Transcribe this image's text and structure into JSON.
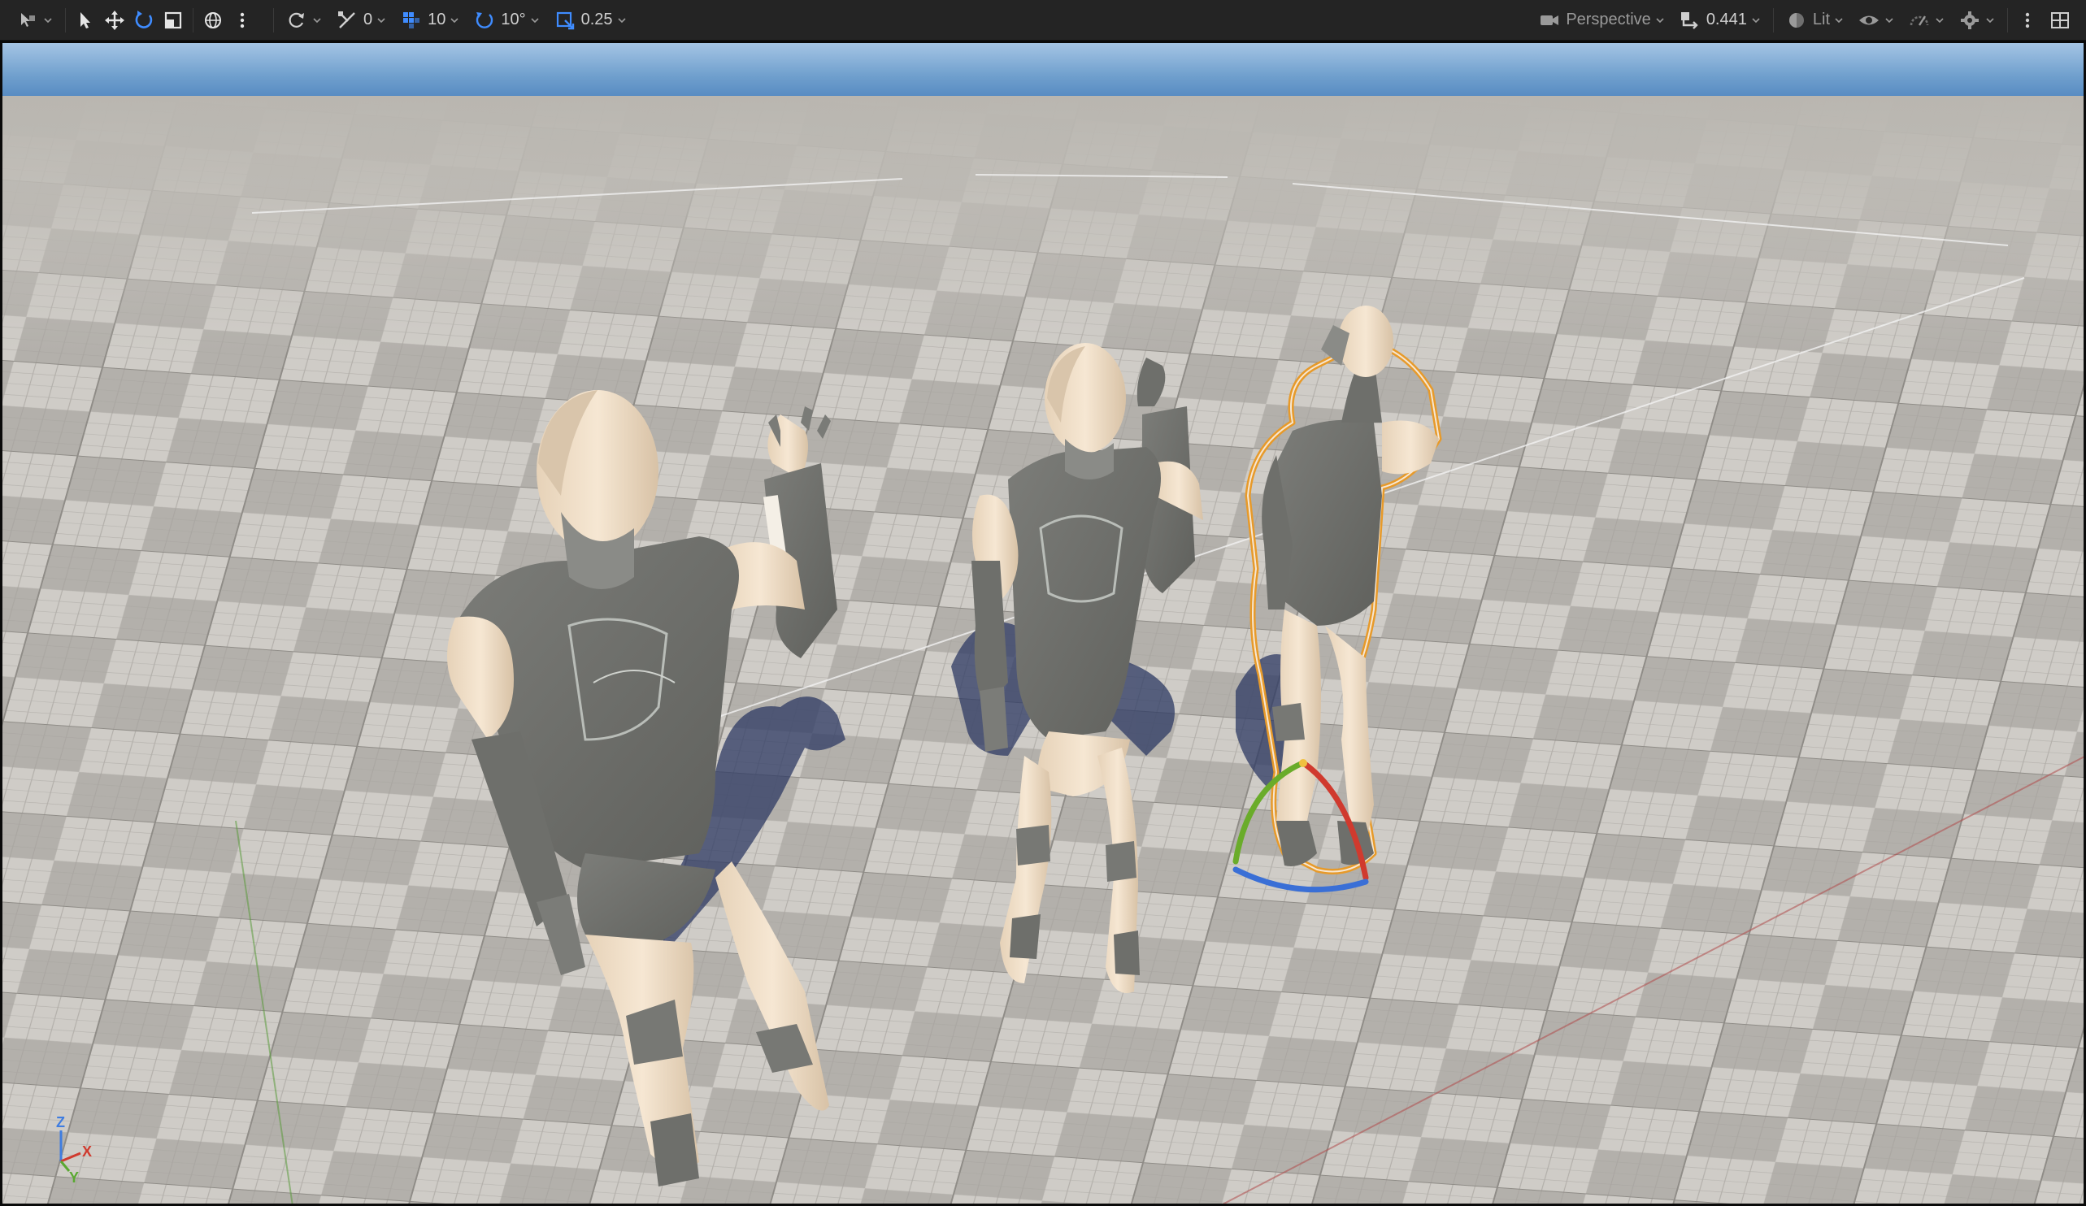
{
  "toolbar": {
    "translate_snap": "0",
    "grid_snap": "10",
    "rotation_snap": "10°",
    "scale_snap": "0.25",
    "view_mode": "Perspective",
    "camera_speed": "0.441",
    "lighting_mode": "Lit"
  },
  "axis_indicator": {
    "z": "Z",
    "x": "X",
    "y": "Y"
  },
  "colors": {
    "toolbar_bg": "#242424",
    "accent_blue": "#3f8cff",
    "selection_outline": "#e79a2a",
    "gizmo_x": "#d03a2e",
    "gizmo_y": "#6aac2a",
    "gizmo_z": "#3a6fd6"
  },
  "icons": [
    "select-mode-icon",
    "select-arrow-icon",
    "translate-icon",
    "rotate-icon",
    "scale-icon",
    "world-space-icon",
    "more-options-icon",
    "surface-snap-icon",
    "translate-snap-icon",
    "grid-snap-icon",
    "rotation-snap-icon",
    "scale-snap-icon",
    "camera-icon",
    "camera-speed-icon",
    "lit-icon",
    "show-icon",
    "realtime-icon",
    "settings-icon",
    "layout-icon"
  ]
}
